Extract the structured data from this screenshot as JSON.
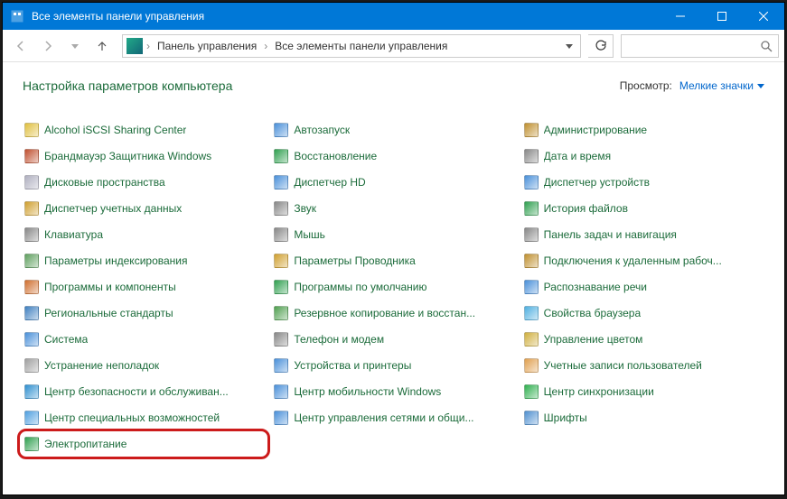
{
  "window": {
    "title": "Все элементы панели управления"
  },
  "breadcrumb": {
    "root": "Панель управления",
    "current": "Все элементы панели управления"
  },
  "search": {
    "placeholder": ""
  },
  "header": {
    "heading": "Настройка параметров компьютера",
    "view_label": "Просмотр:",
    "view_value": "Мелкие значки"
  },
  "items": {
    "c0": [
      "Alcohol iSCSI Sharing Center",
      "Брандмауэр Защитника Windows",
      "Дисковые пространства",
      "Диспетчер учетных данных",
      "Клавиатура",
      "Параметры индексирования",
      "Программы и компоненты",
      "Региональные стандарты",
      "Система",
      "Устранение неполадок",
      "Центр безопасности и обслуживан...",
      "Центр специальных возможностей",
      "Электропитание"
    ],
    "c1": [
      "Автозапуск",
      "Восстановление",
      "Диспетчер HD",
      "Звук",
      "Мышь",
      "Параметры Проводника",
      "Программы по умолчанию",
      "Резервное копирование и восстан...",
      "Телефон и модем",
      "Устройства и принтеры",
      "Центр мобильности Windows",
      "Центр управления сетями и общи..."
    ],
    "c2": [
      "Администрирование",
      "Дата и время",
      "Диспетчер устройств",
      "История файлов",
      "Панель задач и навигация",
      "Подключения к удаленным рабоч...",
      "Распознавание речи",
      "Свойства браузера",
      "Управление цветом",
      "Учетные записи пользователей",
      "Центр синхронизации",
      "Шрифты"
    ]
  },
  "iconColors": {
    "c0": [
      "#e0c040",
      "#c05030",
      "#b0b0c0",
      "#d0a030",
      "#888",
      "#60a060",
      "#d07030",
      "#4080c0",
      "#4a90d9",
      "#a0a0a0",
      "#3090d0",
      "#50a0e0",
      "#30a050"
    ],
    "c1": [
      "#4a90d9",
      "#30a050",
      "#4a90d9",
      "#888",
      "#888",
      "#d0a030",
      "#30a050",
      "#50a050",
      "#888",
      "#4a90d9",
      "#4a90d9",
      "#4a90d9"
    ],
    "c2": [
      "#c09030",
      "#888",
      "#4a90d9",
      "#30a050",
      "#888",
      "#c09030",
      "#4a90d9",
      "#50b0e0",
      "#d0b040",
      "#e0a050",
      "#30b050",
      "#5090d0"
    ]
  }
}
